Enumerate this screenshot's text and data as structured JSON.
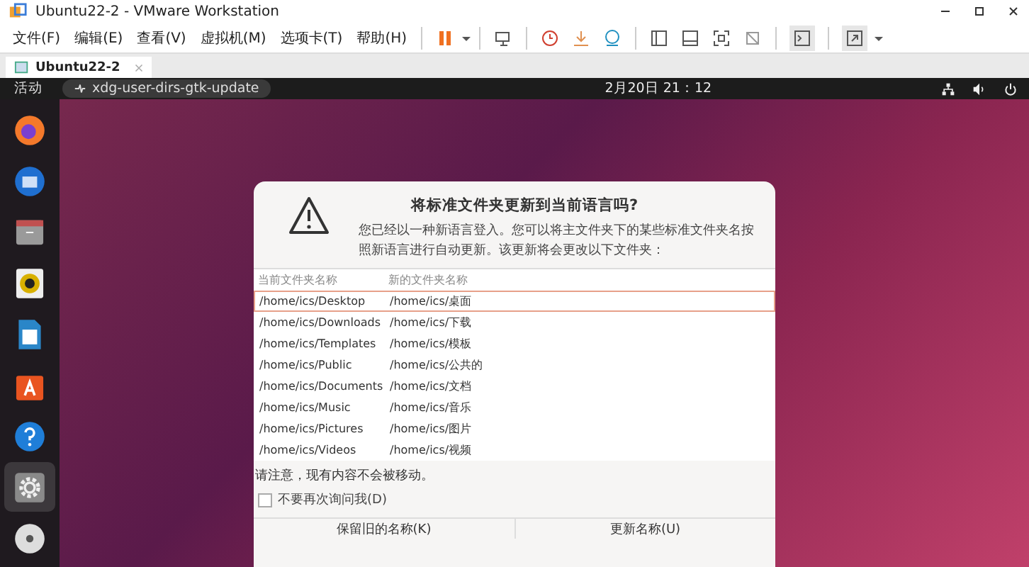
{
  "window": {
    "title": "Ubuntu22-2 - VMware Workstation"
  },
  "menu": [
    "文件(F)",
    "编辑(E)",
    "查看(V)",
    "虚拟机(M)",
    "选项卡(T)",
    "帮助(H)"
  ],
  "tabs": [
    {
      "label": "Ubuntu22-2",
      "selected": true
    }
  ],
  "top_bar": {
    "activities": "活动",
    "app": "xdg-user-dirs-gtk-update",
    "clock": "2月20日  21：12"
  },
  "dock": [
    {
      "kind": "browser",
      "selected": false
    },
    {
      "kind": "mail",
      "selected": false
    },
    {
      "kind": "files",
      "selected": false
    },
    {
      "kind": "music",
      "selected": false
    },
    {
      "kind": "document",
      "selected": false
    },
    {
      "kind": "store",
      "selected": false
    },
    {
      "kind": "help",
      "selected": false
    },
    {
      "kind": "settings",
      "selected": true
    },
    {
      "kind": "disc",
      "selected": false
    }
  ],
  "dialog": {
    "title": "将标准文件夹更新到当前语言吗?",
    "description": "您已经以一种新语言登入。您可以将主文件夹下的某些标准文件夹名按照新语言进行自动更新。该更新将会更改以下文件夹：",
    "columns": [
      "当前文件夹名称",
      "新的文件夹名称"
    ],
    "rows": [
      {
        "current": "/home/ics/Desktop",
        "new": "/home/ics/桌面",
        "selected": true
      },
      {
        "current": "/home/ics/Downloads",
        "new": "/home/ics/下载",
        "selected": false
      },
      {
        "current": "/home/ics/Templates",
        "new": "/home/ics/模板",
        "selected": false
      },
      {
        "current": "/home/ics/Public",
        "new": "/home/ics/公共的",
        "selected": false
      },
      {
        "current": "/home/ics/Documents",
        "new": "/home/ics/文档",
        "selected": false
      },
      {
        "current": "/home/ics/Music",
        "new": "/home/ics/音乐",
        "selected": false
      },
      {
        "current": "/home/ics/Pictures",
        "new": "/home/ics/图片",
        "selected": false
      },
      {
        "current": "/home/ics/Videos",
        "new": "/home/ics/视频",
        "selected": false
      }
    ],
    "note": "请注意，现有内容不会被移动。",
    "checkbox": {
      "label": "不要再次询问我(D)",
      "checked": false
    },
    "buttons": [
      "保留旧的名称(K)",
      "更新名称(U)"
    ]
  }
}
